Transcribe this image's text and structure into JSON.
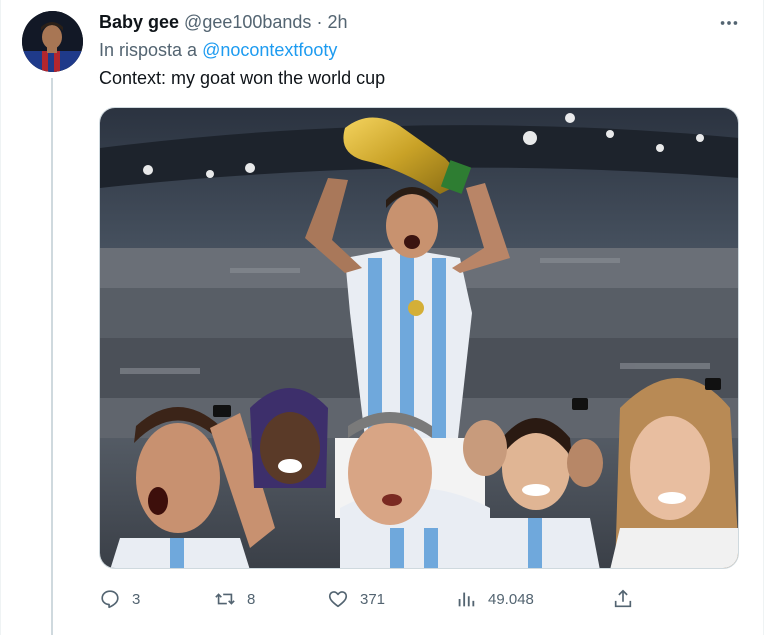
{
  "tweet": {
    "display_name": "Baby gee",
    "handle": "@gee100bands",
    "separator": "·",
    "time": "2h",
    "reply_prefix": "In risposta a",
    "reply_to": "@nocontextfooty",
    "text": "Context: my goat won the world cup",
    "media_icon": "photo-meme-world-cup"
  },
  "actions": {
    "replies": "3",
    "retweets": "8",
    "likes": "371",
    "views": "49.048"
  },
  "icons": {
    "more": "more-horizontal-icon",
    "reply": "reply-icon",
    "retweet": "retweet-icon",
    "like": "heart-icon",
    "views": "views-icon",
    "share": "share-icon"
  },
  "colors": {
    "accent": "#1d9bf0",
    "muted": "#536471",
    "text": "#0f1419",
    "thread_line": "#cfd9de"
  }
}
